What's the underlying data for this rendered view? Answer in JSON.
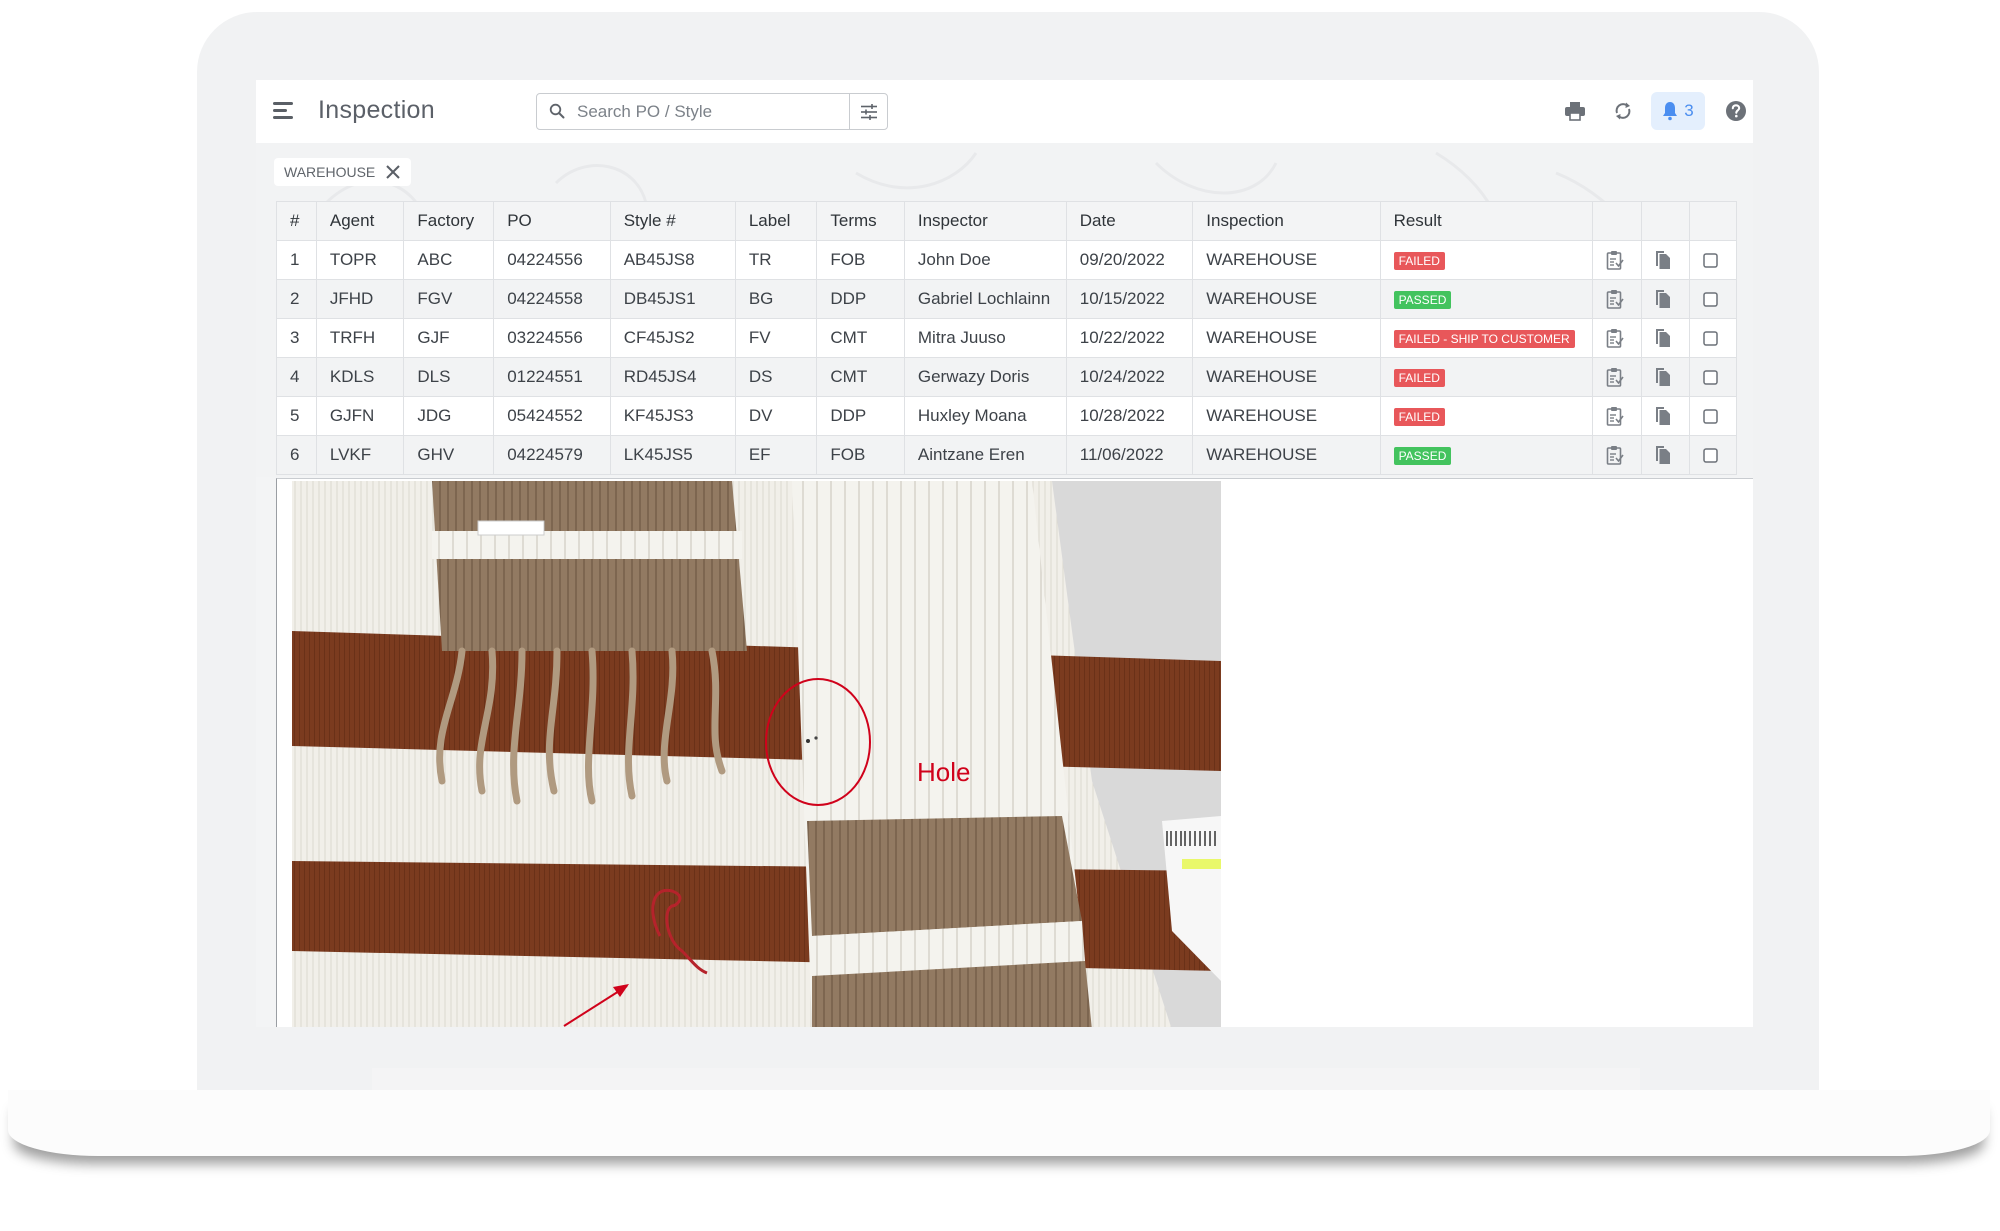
{
  "header": {
    "title": "Inspection",
    "search_placeholder": "Search PO / Style",
    "notification_count": "3",
    "icons": [
      "menu-icon",
      "search-icon",
      "filter-sliders-icon",
      "print-icon",
      "refresh-icon",
      "bell-icon",
      "help-icon"
    ]
  },
  "filters": {
    "chips": [
      {
        "label": "WAREHOUSE"
      }
    ]
  },
  "table": {
    "columns": [
      "#",
      "Agent",
      "Factory",
      "PO",
      "Style #",
      "Label",
      "Terms",
      "Inspector",
      "Date",
      "Inspection",
      "Result",
      "",
      "",
      ""
    ],
    "rows": [
      {
        "num": "1",
        "agent": "TOPR",
        "factory": "ABC",
        "po": "04224556",
        "style": "AB45JS8",
        "label": "TR",
        "terms": "FOB",
        "inspector": "John Doe",
        "date": "09/20/2022",
        "inspection": "WAREHOUSE",
        "result": "FAILED",
        "result_status": "failed"
      },
      {
        "num": "2",
        "agent": "JFHD",
        "factory": "FGV",
        "po": "04224558",
        "style": "DB45JS1",
        "label": "BG",
        "terms": "DDP",
        "inspector": "Gabriel Lochlainn",
        "date": "10/15/2022",
        "inspection": "WAREHOUSE",
        "result": "PASSED",
        "result_status": "passed"
      },
      {
        "num": "3",
        "agent": "TRFH",
        "factory": "GJF",
        "po": "03224556",
        "style": "CF45JS2",
        "label": "FV",
        "terms": "CMT",
        "inspector": "Mitra Juuso",
        "date": "10/22/2022",
        "inspection": "WAREHOUSE",
        "result": "FAILED - SHIP TO CUSTOMER",
        "result_status": "failed"
      },
      {
        "num": "4",
        "agent": "KDLS",
        "factory": "DLS",
        "po": "01224551",
        "style": "RD45JS4",
        "label": "DS",
        "terms": "CMT",
        "inspector": "Gerwazy Doris",
        "date": "10/24/2022",
        "inspection": "WAREHOUSE",
        "result": "FAILED",
        "result_status": "failed"
      },
      {
        "num": "5",
        "agent": "GJFN",
        "factory": "JDG",
        "po": "05424552",
        "style": "KF45JS3",
        "label": "DV",
        "terms": "DDP",
        "inspector": "Huxley Moana",
        "date": "10/28/2022",
        "inspection": "WAREHOUSE",
        "result": "FAILED",
        "result_status": "failed"
      },
      {
        "num": "6",
        "agent": "LVKF",
        "factory": "GHV",
        "po": "04224579",
        "style": "LK45JS5",
        "label": "EF",
        "terms": "FOB",
        "inspector": "Aintzane Eren",
        "date": "11/06/2022",
        "inspection": "WAREHOUSE",
        "result": "PASSED",
        "result_status": "passed"
      }
    ],
    "row_actions": [
      "clipboard-check-icon",
      "copy-document-icon",
      "checkbox"
    ]
  },
  "photo": {
    "annotation_label": "Hole",
    "description": "Knit scarf with brown and white stripes, red circle marking hole defect, red arrow pointing to loose thread"
  },
  "colors": {
    "failed": "#e8575a",
    "passed": "#43c35e",
    "accent": "#4b8ef0",
    "annotation": "#d0021b"
  }
}
